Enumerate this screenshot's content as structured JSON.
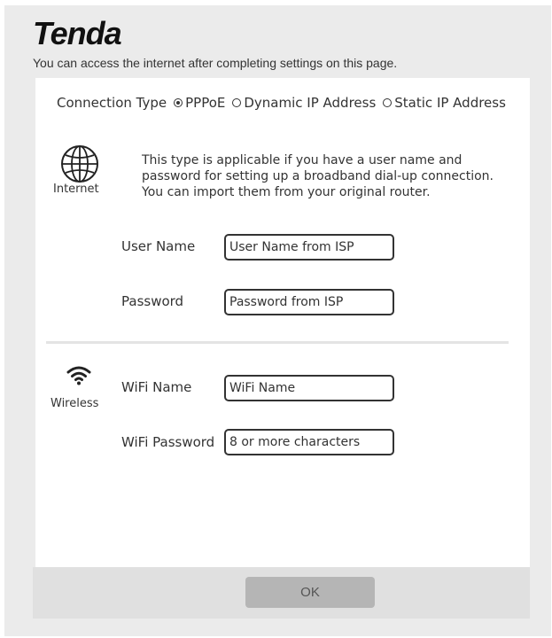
{
  "brand": {
    "logo_text": "Tenda"
  },
  "header": {
    "tagline": "You can access the internet after completing settings on this page."
  },
  "connection": {
    "label": "Connection Type",
    "options": [
      {
        "label": "PPPoE",
        "selected": true
      },
      {
        "label": "Dynamic IP Address",
        "selected": false
      },
      {
        "label": "Static IP Address",
        "selected": false
      }
    ]
  },
  "internet": {
    "icon": "globe-icon",
    "label": "Internet",
    "description": "This type is applicable if you have a user name and password for setting up a broadband dial-up connection. You can import them from your original router.",
    "username_label": "User Name",
    "username_placeholder": "User Name from ISP",
    "password_label": "Password",
    "password_placeholder": "Password from ISP"
  },
  "wireless": {
    "icon": "wifi-icon",
    "label": "Wireless",
    "wifi_name_label": "WiFi Name",
    "wifi_name_placeholder": "WiFi Name",
    "wifi_password_label": "WiFi Password",
    "wifi_password_placeholder": "8 or more characters"
  },
  "footer": {
    "ok_label": "OK"
  }
}
